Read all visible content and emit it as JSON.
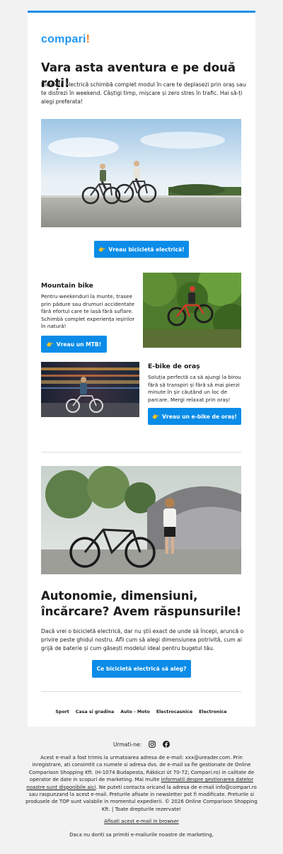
{
  "brand": {
    "name": "compari",
    "mark": "!"
  },
  "hero": {
    "title": "Vara asta aventura e pe două roți!",
    "text": "Bicicleta electrică schimbă complet modul în care te deplasezi prin oraș sau te distrezi în weekend. Câștigi timp, mișcare și zero stres în trafic. Hai să-ți alegi preferata!",
    "cta": "Vreau bicicletă electrică!"
  },
  "mtb": {
    "title": "Mountain bike",
    "text": "Pentru weekenduri la munte, trasee prin pădure sau drumuri accidentate fără efortul care te lasă fără suflare. Schimbă complet experiența ieșirilor în natură!",
    "cta": "Vreau un MTB!"
  },
  "city": {
    "title": "E-bike de oraș",
    "text": "Soluția perfectă ca să ajungi la birou fără să transpiri și fără să mai pierzi minute în șir căutând un loc de parcare. Mergi relaxat prin oraș!",
    "cta": "Vreau un e-bike de oraș!"
  },
  "faq": {
    "title": "Autonomie, dimensiuni, încărcare? Avem răspunsurile!",
    "text": "Dacă vrei o bicicletă electrică, dar nu știi exact de unde să începi, aruncă o privire peste ghidul nostru. Afli cum să alegi dimensiunea potrivită, cum ai grijă de baterie și cum găsești modelul ideal pentru bugetul tău.",
    "cta": "Ce bicicletă electrică să aleg?"
  },
  "categories": [
    "Sport",
    "Casa si gradina",
    "Auto - Moto",
    "Electrocasnice",
    "Electronice"
  ],
  "social": {
    "label": "Urmati-ne:",
    "icons": [
      "instagram-icon",
      "facebook-icon"
    ]
  },
  "footer": {
    "text1": "Acest e-mail a fost trimis la urmatoarea adresa de e-mail: xxx@ureader.com. Prin inregistrare, ati consimtit ca numele si adresa dvs. de e-mail sa fie gestionate de Online Comparison Shopping Kft. (H-1074 Budapesta, Rákóczi út 70-72; Compari.ro) in calitate de operator de date in scopuri de marketing. Mai multe ",
    "link": "informatii despre gestionarea datelor noastre sunt disponibile aici",
    "text2": ". Ne puteti contacta oricand la adresa de e-mail info@compari.ro sau raspunzand la acest e-mail. Preturile afisate in newsletter pot fi modificate. Preturile si produsele de TOP sunt valabile in momentul expedierii. © 2026 Online Comparison Shopping Kft. | Toate drepturile rezervate!",
    "browser_link": "Afisati acest e-mail in browser",
    "unsubscribe": "Daca nu doriti sa primiti e-mailurile noastre de marketing,"
  },
  "colors": {
    "accent": "#0a8ce8",
    "brand_blue": "#2196f3",
    "brand_orange": "#ff7a1a",
    "top_bar": "#1e8fea"
  }
}
